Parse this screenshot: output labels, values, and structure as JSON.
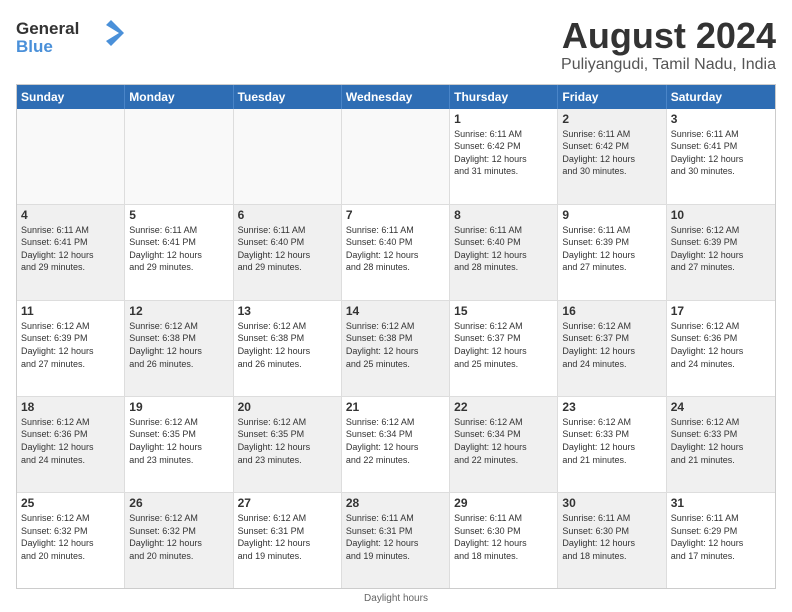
{
  "header": {
    "logo_line1": "General",
    "logo_line2": "Blue",
    "title": "August 2024",
    "subtitle": "Puliyangudi, Tamil Nadu, India"
  },
  "calendar": {
    "weekdays": [
      "Sunday",
      "Monday",
      "Tuesday",
      "Wednesday",
      "Thursday",
      "Friday",
      "Saturday"
    ],
    "rows": [
      [
        {
          "day": "",
          "info": "",
          "empty": true
        },
        {
          "day": "",
          "info": "",
          "empty": true
        },
        {
          "day": "",
          "info": "",
          "empty": true
        },
        {
          "day": "",
          "info": "",
          "empty": true
        },
        {
          "day": "1",
          "info": "Sunrise: 6:11 AM\nSunset: 6:42 PM\nDaylight: 12 hours\nand 31 minutes.",
          "shaded": false
        },
        {
          "day": "2",
          "info": "Sunrise: 6:11 AM\nSunset: 6:42 PM\nDaylight: 12 hours\nand 30 minutes.",
          "shaded": true
        },
        {
          "day": "3",
          "info": "Sunrise: 6:11 AM\nSunset: 6:41 PM\nDaylight: 12 hours\nand 30 minutes.",
          "shaded": false
        }
      ],
      [
        {
          "day": "4",
          "info": "Sunrise: 6:11 AM\nSunset: 6:41 PM\nDaylight: 12 hours\nand 29 minutes.",
          "shaded": true
        },
        {
          "day": "5",
          "info": "Sunrise: 6:11 AM\nSunset: 6:41 PM\nDaylight: 12 hours\nand 29 minutes.",
          "shaded": false
        },
        {
          "day": "6",
          "info": "Sunrise: 6:11 AM\nSunset: 6:40 PM\nDaylight: 12 hours\nand 29 minutes.",
          "shaded": true
        },
        {
          "day": "7",
          "info": "Sunrise: 6:11 AM\nSunset: 6:40 PM\nDaylight: 12 hours\nand 28 minutes.",
          "shaded": false
        },
        {
          "day": "8",
          "info": "Sunrise: 6:11 AM\nSunset: 6:40 PM\nDaylight: 12 hours\nand 28 minutes.",
          "shaded": true
        },
        {
          "day": "9",
          "info": "Sunrise: 6:11 AM\nSunset: 6:39 PM\nDaylight: 12 hours\nand 27 minutes.",
          "shaded": false
        },
        {
          "day": "10",
          "info": "Sunrise: 6:12 AM\nSunset: 6:39 PM\nDaylight: 12 hours\nand 27 minutes.",
          "shaded": true
        }
      ],
      [
        {
          "day": "11",
          "info": "Sunrise: 6:12 AM\nSunset: 6:39 PM\nDaylight: 12 hours\nand 27 minutes.",
          "shaded": false
        },
        {
          "day": "12",
          "info": "Sunrise: 6:12 AM\nSunset: 6:38 PM\nDaylight: 12 hours\nand 26 minutes.",
          "shaded": true
        },
        {
          "day": "13",
          "info": "Sunrise: 6:12 AM\nSunset: 6:38 PM\nDaylight: 12 hours\nand 26 minutes.",
          "shaded": false
        },
        {
          "day": "14",
          "info": "Sunrise: 6:12 AM\nSunset: 6:38 PM\nDaylight: 12 hours\nand 25 minutes.",
          "shaded": true
        },
        {
          "day": "15",
          "info": "Sunrise: 6:12 AM\nSunset: 6:37 PM\nDaylight: 12 hours\nand 25 minutes.",
          "shaded": false
        },
        {
          "day": "16",
          "info": "Sunrise: 6:12 AM\nSunset: 6:37 PM\nDaylight: 12 hours\nand 24 minutes.",
          "shaded": true
        },
        {
          "day": "17",
          "info": "Sunrise: 6:12 AM\nSunset: 6:36 PM\nDaylight: 12 hours\nand 24 minutes.",
          "shaded": false
        }
      ],
      [
        {
          "day": "18",
          "info": "Sunrise: 6:12 AM\nSunset: 6:36 PM\nDaylight: 12 hours\nand 24 minutes.",
          "shaded": true
        },
        {
          "day": "19",
          "info": "Sunrise: 6:12 AM\nSunset: 6:35 PM\nDaylight: 12 hours\nand 23 minutes.",
          "shaded": false
        },
        {
          "day": "20",
          "info": "Sunrise: 6:12 AM\nSunset: 6:35 PM\nDaylight: 12 hours\nand 23 minutes.",
          "shaded": true
        },
        {
          "day": "21",
          "info": "Sunrise: 6:12 AM\nSunset: 6:34 PM\nDaylight: 12 hours\nand 22 minutes.",
          "shaded": false
        },
        {
          "day": "22",
          "info": "Sunrise: 6:12 AM\nSunset: 6:34 PM\nDaylight: 12 hours\nand 22 minutes.",
          "shaded": true
        },
        {
          "day": "23",
          "info": "Sunrise: 6:12 AM\nSunset: 6:33 PM\nDaylight: 12 hours\nand 21 minutes.",
          "shaded": false
        },
        {
          "day": "24",
          "info": "Sunrise: 6:12 AM\nSunset: 6:33 PM\nDaylight: 12 hours\nand 21 minutes.",
          "shaded": true
        }
      ],
      [
        {
          "day": "25",
          "info": "Sunrise: 6:12 AM\nSunset: 6:32 PM\nDaylight: 12 hours\nand 20 minutes.",
          "shaded": false
        },
        {
          "day": "26",
          "info": "Sunrise: 6:12 AM\nSunset: 6:32 PM\nDaylight: 12 hours\nand 20 minutes.",
          "shaded": true
        },
        {
          "day": "27",
          "info": "Sunrise: 6:12 AM\nSunset: 6:31 PM\nDaylight: 12 hours\nand 19 minutes.",
          "shaded": false
        },
        {
          "day": "28",
          "info": "Sunrise: 6:11 AM\nSunset: 6:31 PM\nDaylight: 12 hours\nand 19 minutes.",
          "shaded": true
        },
        {
          "day": "29",
          "info": "Sunrise: 6:11 AM\nSunset: 6:30 PM\nDaylight: 12 hours\nand 18 minutes.",
          "shaded": false
        },
        {
          "day": "30",
          "info": "Sunrise: 6:11 AM\nSunset: 6:30 PM\nDaylight: 12 hours\nand 18 minutes.",
          "shaded": true
        },
        {
          "day": "31",
          "info": "Sunrise: 6:11 AM\nSunset: 6:29 PM\nDaylight: 12 hours\nand 17 minutes.",
          "shaded": false
        }
      ]
    ]
  },
  "footer": {
    "note": "Daylight hours"
  }
}
